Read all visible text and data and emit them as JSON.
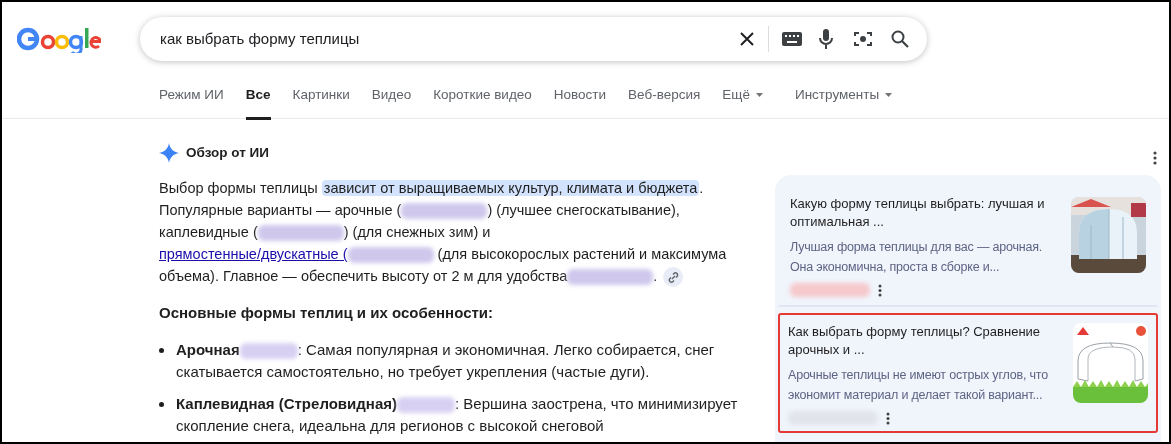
{
  "search": {
    "query": "как выбрать форму теплицы"
  },
  "tabs": [
    {
      "label": "Режим ИИ",
      "selected": false,
      "menu": false
    },
    {
      "label": "Все",
      "selected": true,
      "menu": false
    },
    {
      "label": "Картинки",
      "selected": false,
      "menu": false
    },
    {
      "label": "Видео",
      "selected": false,
      "menu": false
    },
    {
      "label": "Короткие видео",
      "selected": false,
      "menu": false
    },
    {
      "label": "Новости",
      "selected": false,
      "menu": false
    },
    {
      "label": "Веб-версия",
      "selected": false,
      "menu": false
    },
    {
      "label": "Ещё",
      "selected": false,
      "menu": true
    },
    {
      "label": "Инструменты",
      "selected": false,
      "menu": true
    }
  ],
  "ai_overview": {
    "title": "Обзор от ИИ",
    "paragraph": [
      {
        "kind": "text",
        "text": "Выбор формы теплицы "
      },
      {
        "kind": "highlight",
        "text": "зависит от выращиваемых культур, климата и бюджета"
      },
      {
        "kind": "text",
        "text": ". Популярные варианты — арочные ("
      },
      {
        "kind": "blur"
      },
      {
        "kind": "text",
        "text": ") (лучшее снегоскатывание), каплевидные ("
      },
      {
        "kind": "blur"
      },
      {
        "kind": "text",
        "text": ") (для снежных зим) и "
      },
      {
        "kind": "link",
        "text": "прямостенные/двускатные ("
      },
      {
        "kind": "blur"
      },
      {
        "kind": "text",
        "text": " (для высокорослых растений и максимума объема). Главное — обеспечить высоту от 2 м для удобства"
      },
      {
        "kind": "blur"
      },
      {
        "kind": "text",
        "text": "."
      },
      {
        "kind": "citation"
      }
    ],
    "heading": "Основные формы теплиц и их особенности:",
    "bullets": [
      {
        "label": "Арочная",
        "text": ": Самая популярная и экономичная. Легко собирается, снег скатывается самостоятельно, но требует укрепления (частые дуги)."
      },
      {
        "label": "Каплевидная (Стреловидная)",
        "text": ": Вершина заострена, что минимизирует скопление снега, идеальна для регионов с высокой снеговой"
      }
    ]
  },
  "sources": [
    {
      "title": "Какую форму теплицы выбрать: лучшая и оптимальная ...",
      "snippet": "Лучшая форма теплицы для вас — арочная. Она экономична, проста в сборке и...",
      "highlighted": false,
      "kind": "picture"
    },
    {
      "title": "Как выбрать форму теплицы? Сравнение арочных и ...",
      "snippet": "Арочные теплицы не имеют острых углов, что экономит материал и делает такой вариант...",
      "highlighted": true,
      "kind": "picture"
    }
  ]
}
